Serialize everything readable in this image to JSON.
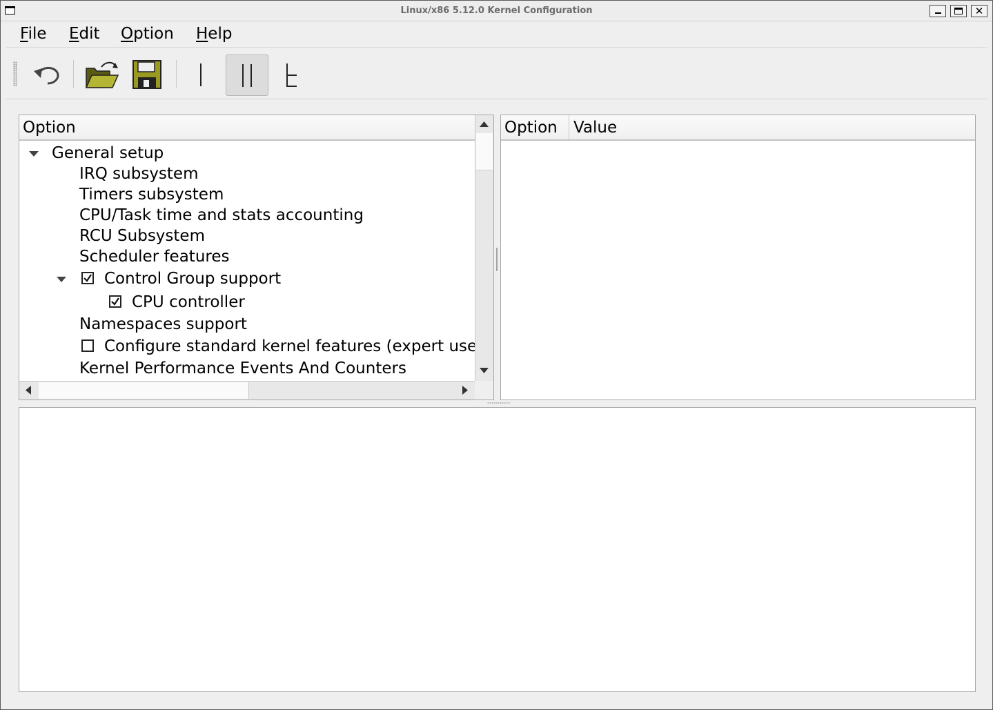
{
  "window": {
    "title": "Linux/x86 5.12.0 Kernel Configuration",
    "buttons": {
      "minimize": "minimize",
      "maximize": "maximize",
      "close": "✕"
    }
  },
  "menubar": {
    "items": [
      {
        "mnemonic": "F",
        "rest": "ile"
      },
      {
        "mnemonic": "E",
        "rest": "dit"
      },
      {
        "mnemonic": "O",
        "rest": "ption"
      },
      {
        "mnemonic": "H",
        "rest": "elp"
      }
    ]
  },
  "toolbar": {
    "buttons": [
      {
        "icon": "undo-icon"
      },
      {
        "icon": "open-folder-icon"
      },
      {
        "icon": "save-icon"
      },
      {
        "icon": "single-view-icon"
      },
      {
        "icon": "split-view-icon",
        "active": true
      },
      {
        "icon": "full-view-icon"
      }
    ]
  },
  "tree": {
    "header": "Option",
    "rows": [
      {
        "label": "General setup",
        "expanded": true,
        "level": 0
      },
      {
        "label": "IRQ subsystem",
        "level": 1
      },
      {
        "label": "Timers subsystem",
        "level": 1
      },
      {
        "label": "CPU/Task time and stats accounting",
        "level": 1
      },
      {
        "label": "RCU Subsystem",
        "level": 1
      },
      {
        "label": "Scheduler features",
        "level": 1
      },
      {
        "label": "Control Group support",
        "level": 1,
        "expanded": true,
        "checked": true
      },
      {
        "label": "CPU controller",
        "level": 2,
        "checked": true
      },
      {
        "label": "Namespaces support",
        "level": 1
      },
      {
        "label": "Configure standard kernel features (expert users)",
        "level": 1,
        "checked": false
      },
      {
        "label": "Kernel Performance Events And Counters",
        "level": 1
      }
    ]
  },
  "info": {
    "columns": [
      "Option",
      "Value"
    ]
  },
  "colors": {
    "background": "#efefef",
    "panel": "#ffffff",
    "border": "#a8a8a8",
    "title_text": "#6b6b6b"
  }
}
